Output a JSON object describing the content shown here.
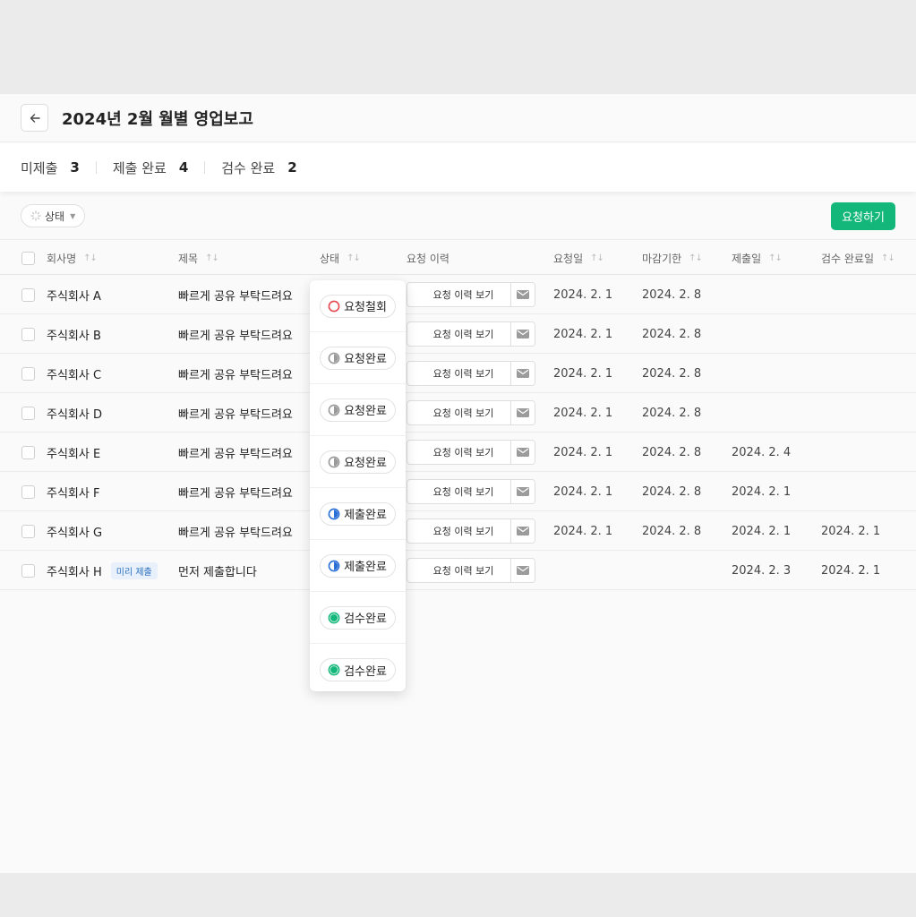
{
  "header": {
    "title": "2024년 2월 월별 영업보고"
  },
  "summary": [
    {
      "label": "미제출",
      "value": "3"
    },
    {
      "label": "제출 완료",
      "value": "4"
    },
    {
      "label": "검수 완료",
      "value": "2"
    }
  ],
  "filter": {
    "label": "상태"
  },
  "request_button": {
    "label": "요청하기"
  },
  "columns": {
    "company": "회사명",
    "title": "제목",
    "status": "상태",
    "history": "요청 이력",
    "requested": "요청일",
    "deadline": "마감기한",
    "submitted": "제출일",
    "reviewed": "검수 완료일"
  },
  "history_button_label": "요청 이력 보기",
  "rows": [
    {
      "company": "주식회사 A",
      "title": "빠르게 공유 부탁드려요",
      "requested": "2024. 2. 1",
      "deadline": "2024. 2. 8",
      "submitted": "",
      "reviewed": ""
    },
    {
      "company": "주식회사 B",
      "title": "빠르게 공유 부탁드려요",
      "requested": "2024. 2. 1",
      "deadline": "2024. 2. 8",
      "submitted": "",
      "reviewed": ""
    },
    {
      "company": "주식회사 C",
      "title": "빠르게 공유 부탁드려요",
      "requested": "2024. 2. 1",
      "deadline": "2024. 2. 8",
      "submitted": "",
      "reviewed": ""
    },
    {
      "company": "주식회사 D",
      "title": "빠르게 공유 부탁드려요",
      "requested": "2024. 2. 1",
      "deadline": "2024. 2. 8",
      "submitted": "",
      "reviewed": ""
    },
    {
      "company": "주식회사 E",
      "title": "빠르게 공유 부탁드려요",
      "requested": "2024. 2. 1",
      "deadline": "2024. 2. 8",
      "submitted": "2024. 2. 4",
      "reviewed": ""
    },
    {
      "company": "주식회사 F",
      "title": "빠르게 공유 부탁드려요",
      "requested": "2024. 2. 1",
      "deadline": "2024. 2. 8",
      "submitted": "2024. 2. 1",
      "reviewed": ""
    },
    {
      "company": "주식회사 G",
      "title": "빠르게 공유 부탁드려요",
      "requested": "2024. 2. 1",
      "deadline": "2024. 2. 8",
      "submitted": "2024. 2. 1",
      "reviewed": "2024. 2. 1"
    },
    {
      "company": "주식회사 H",
      "badge": "미리 제출",
      "title": "먼저 제출합니다",
      "requested": "",
      "deadline": "",
      "submitted": "2024. 2. 3",
      "reviewed": "2024. 2. 1"
    }
  ],
  "status_options": [
    {
      "label": "요청철회",
      "icon": "ring-icon",
      "color": "#e5484d"
    },
    {
      "label": "요청완료",
      "icon": "half-circle-icon",
      "color": "#9a9a9a"
    },
    {
      "label": "요청완료",
      "icon": "half-circle-icon",
      "color": "#9a9a9a"
    },
    {
      "label": "요청완료",
      "icon": "half-circle-icon",
      "color": "#9a9a9a"
    },
    {
      "label": "제출완료",
      "icon": "half-circle-icon",
      "color": "#2a6fd6"
    },
    {
      "label": "제출완료",
      "icon": "half-circle-icon",
      "color": "#2a6fd6"
    },
    {
      "label": "검수완료",
      "icon": "filled-circle-icon",
      "color": "#14b77a"
    },
    {
      "label": "검수완료",
      "icon": "filled-circle-icon",
      "color": "#14b77a"
    }
  ],
  "colors": {
    "accent": "#14b77a",
    "badge_bg": "#e8f1fb",
    "badge_text": "#2a6fbf"
  }
}
